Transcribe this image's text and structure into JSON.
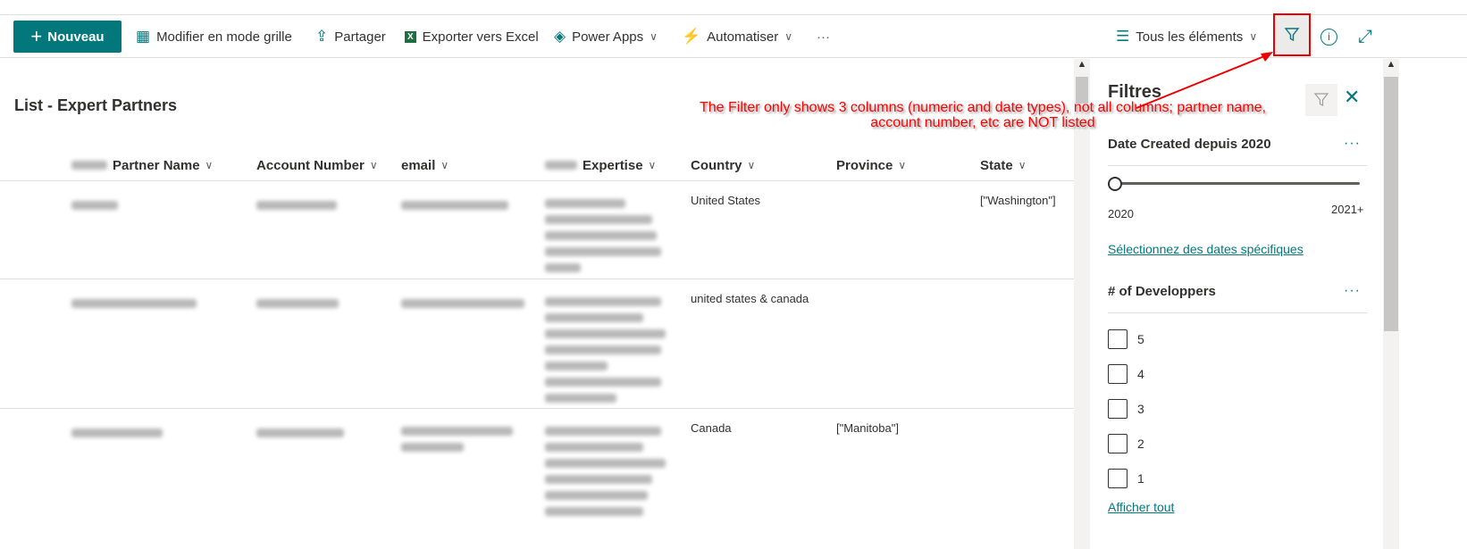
{
  "toolbar": {
    "new_label": "Nouveau",
    "grid_label": "Modifier en mode grille",
    "share_label": "Partager",
    "export_label": "Exporter vers Excel",
    "powerapps_label": "Power Apps",
    "automate_label": "Automatiser",
    "more": "···",
    "view_label": "Tous les éléments"
  },
  "list": {
    "title": "List - Expert Partners",
    "columns": [
      "Partner Name",
      "Account Number",
      "email",
      "Expertise",
      "Country",
      "Province",
      "State"
    ],
    "rows": [
      {
        "country": "United States",
        "province": "",
        "state": "[\"Washington\"]"
      },
      {
        "country": "united states & canada",
        "province": "",
        "state": ""
      },
      {
        "country": "Canada",
        "province": "[\"Manitoba\"]",
        "state": ""
      }
    ]
  },
  "annotation": "The Filter only shows 3 columns (numeric and date types), not all columns; partner name, account number, etc are NOT listed",
  "filters": {
    "title": "Filtres",
    "date_section": "Date Created depuis 2020",
    "slider_min": "2020",
    "slider_max": "2021+",
    "slider_value": "2020",
    "specific_dates_link": "Sélectionnez des dates spécifiques",
    "dev_section": "# of Developpers",
    "options": [
      "5",
      "4",
      "3",
      "2",
      "1"
    ],
    "show_all": "Afficher tout",
    "more": "···"
  }
}
